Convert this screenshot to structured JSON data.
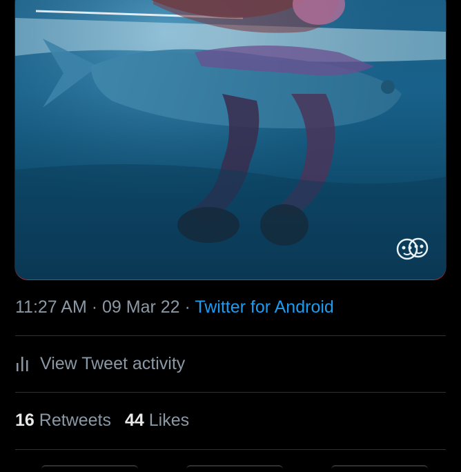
{
  "tweet": {
    "media": {
      "watermark_icon": "cartoon-faces-icon"
    },
    "timestamp": {
      "time": "11:27 AM",
      "separator_1": " · ",
      "date": "09 Mar 22",
      "separator_2": " · ",
      "source": "Twitter for Android"
    },
    "activity": {
      "icon": "bar-chart-icon",
      "label": "View Tweet activity"
    },
    "stats": {
      "retweets_count": "16",
      "retweets_label": "Retweets",
      "likes_count": "44",
      "likes_label": "Likes"
    }
  },
  "colors": {
    "background": "#000000",
    "secondary_text": "#8b98a5",
    "primary_text": "#e7e9ea",
    "link": "#1d9bf0",
    "divider": "#2f3336"
  }
}
